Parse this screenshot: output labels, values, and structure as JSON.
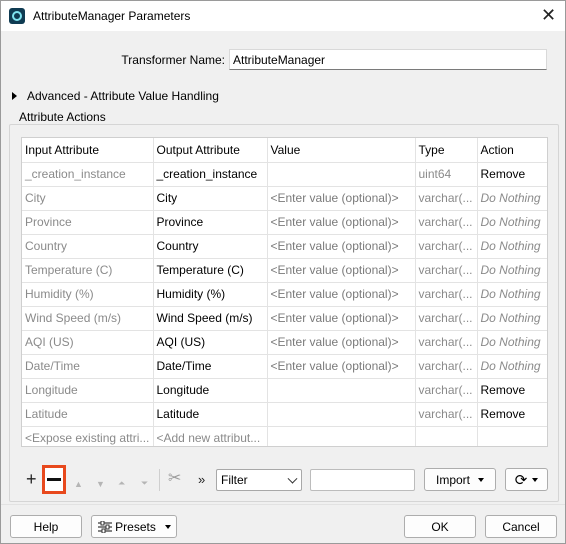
{
  "window": {
    "title": "AttributeManager Parameters",
    "close_label": "✕"
  },
  "transformer_name": {
    "label": "Transformer Name:",
    "value": "AttributeManager"
  },
  "advanced": {
    "label": "Advanced - Attribute Value Handling"
  },
  "attribute_actions": {
    "title": "Attribute Actions",
    "columns": [
      "Input Attribute",
      "Output Attribute",
      "Value",
      "Type",
      "Action"
    ],
    "rows": [
      {
        "input": "_creation_instance",
        "output": "_creation_instance",
        "value": "",
        "type": "uint64",
        "action": "Remove"
      },
      {
        "input": "City",
        "output": "City",
        "value": "<Enter value (optional)>",
        "type": "varchar(...",
        "action": "Do Nothing"
      },
      {
        "input": "Province",
        "output": "Province",
        "value": "<Enter value (optional)>",
        "type": "varchar(...",
        "action": "Do Nothing"
      },
      {
        "input": "Country",
        "output": "Country",
        "value": "<Enter value (optional)>",
        "type": "varchar(...",
        "action": "Do Nothing"
      },
      {
        "input": "Temperature (C)",
        "output": "Temperature (C)",
        "value": "<Enter value (optional)>",
        "type": "varchar(...",
        "action": "Do Nothing"
      },
      {
        "input": "Humidity (%)",
        "output": "Humidity (%)",
        "value": "<Enter value (optional)>",
        "type": "varchar(...",
        "action": "Do Nothing"
      },
      {
        "input": "Wind Speed (m/s)",
        "output": "Wind Speed (m/s)",
        "value": "<Enter value (optional)>",
        "type": "varchar(...",
        "action": "Do Nothing"
      },
      {
        "input": "AQI (US)",
        "output": "AQI (US)",
        "value": "<Enter value (optional)>",
        "type": "varchar(...",
        "action": "Do Nothing"
      },
      {
        "input": "Date/Time",
        "output": "Date/Time",
        "value": "<Enter value (optional)>",
        "type": "varchar(...",
        "action": "Do Nothing"
      },
      {
        "input": "Longitude",
        "output": "Longitude",
        "value": "",
        "type": "varchar(...",
        "action": "Remove"
      },
      {
        "input": "Latitude",
        "output": "Latitude",
        "value": "",
        "type": "varchar(...",
        "action": "Remove"
      },
      {
        "input": "<Expose existing attri...",
        "output": "<Add new attribut...",
        "value": "",
        "type": "",
        "action": ""
      }
    ]
  },
  "toolbar": {
    "add_icon": "plus-icon",
    "remove_icon": "minus-icon",
    "filter_value": "Filter",
    "filter_text": "",
    "import_label": "Import",
    "refresh_icon": "refresh-icon"
  },
  "footer": {
    "help_label": "Help",
    "presets_label": "Presets",
    "ok_label": "OK",
    "cancel_label": "Cancel"
  },
  "colors": {
    "highlight": "#e8491d"
  }
}
